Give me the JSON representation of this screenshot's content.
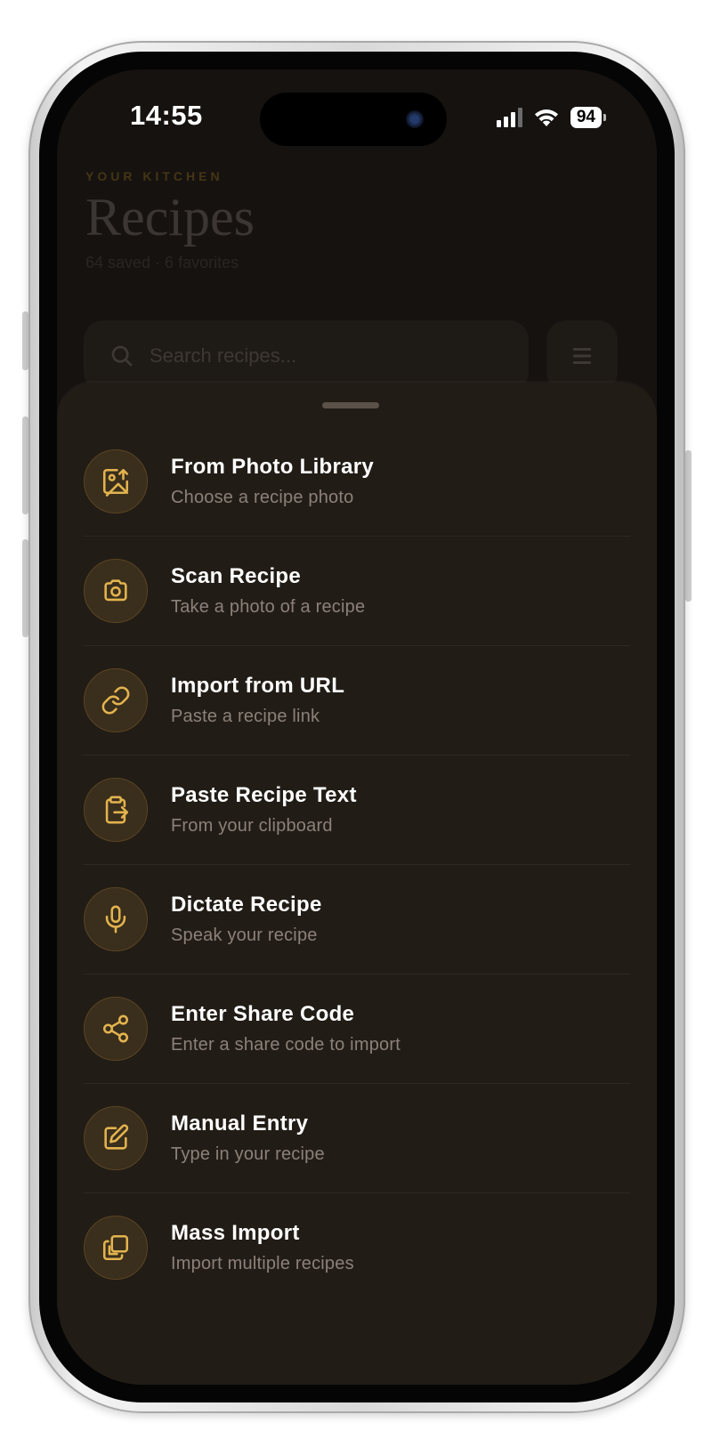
{
  "status_bar": {
    "time": "14:55",
    "battery": "94"
  },
  "background": {
    "eyebrow": "YOUR KITCHEN",
    "title": "Recipes",
    "subtitle": "64 saved · 6 favorites",
    "search_placeholder": "Search recipes..."
  },
  "sheet": {
    "items": [
      {
        "title": "From Photo Library",
        "subtitle": "Choose a recipe photo",
        "icon": "photo-library-icon"
      },
      {
        "title": "Scan Recipe",
        "subtitle": "Take a photo of a recipe",
        "icon": "camera-icon"
      },
      {
        "title": "Import from URL",
        "subtitle": "Paste a recipe link",
        "icon": "link-icon"
      },
      {
        "title": "Paste Recipe Text",
        "subtitle": "From your clipboard",
        "icon": "clipboard-icon"
      },
      {
        "title": "Dictate Recipe",
        "subtitle": "Speak your recipe",
        "icon": "microphone-icon"
      },
      {
        "title": "Enter Share Code",
        "subtitle": "Enter a share code to import",
        "icon": "share-icon"
      },
      {
        "title": "Manual Entry",
        "subtitle": "Type in your recipe",
        "icon": "edit-icon"
      },
      {
        "title": "Mass Import",
        "subtitle": "Import multiple recipes",
        "icon": "copy-icon"
      }
    ]
  },
  "colors": {
    "accent": "#e3b44e",
    "sheet_bg": "#221c16",
    "title_text": "#ffffff",
    "subtitle_text": "#8b8179"
  }
}
